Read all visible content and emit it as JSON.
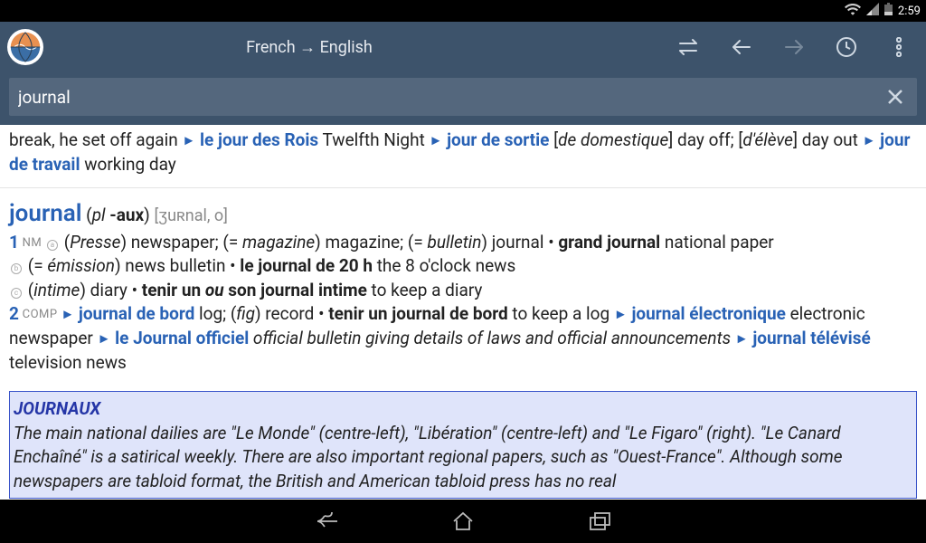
{
  "status": {
    "time": "2:59"
  },
  "header": {
    "title": "French → English"
  },
  "search": {
    "value": "journal"
  },
  "prev": {
    "lead": "break, he set off again",
    "p1": "le jour des Rois",
    "t1": " Twelfth Night ",
    "p2": "jour de sortie",
    "t2a": " [",
    "t2b": "de domestique",
    "t2c": "] day off; [",
    "t2d": "d'élève",
    "t2e": "] day out ",
    "p3": "jour de travail",
    "t3": " working day"
  },
  "entry": {
    "headword": "journal",
    "morph_open": " (",
    "pl_label": "pl ",
    "pl_suffix": "-aux",
    "morph_close": ") ",
    "ipa": "[ʒuʀnal, o]",
    "s1_num": "1",
    "s1_pos": " NM ",
    "s1_a": " (",
    "s1_a_gloss": "Presse",
    "s1_a2": ") newspaper; (= ",
    "s1_b_gloss": "magazine",
    "s1_b2": ") magazine; (= ",
    "s1_c_gloss": "bulletin",
    "s1_c2": ") journal • ",
    "s1_d_bold": "grand journal",
    "s1_d2": " national paper",
    "s1_line2a": " (= ",
    "s1_line2a_gloss": "émission",
    "s1_line2a2": ") news bulletin • ",
    "s1_line2_bold": "le journal de 20 h",
    "s1_line2b": " the 8 o'clock news",
    "s1_line3a": " (",
    "s1_line3_gloss": "intime",
    "s1_line3a2": ") diary • ",
    "s1_line3_bold1": "tenir un ",
    "s1_line3_ital": "ou",
    "s1_line3_bold2": " son journal intime",
    "s1_line3b": " to keep a diary",
    "s2_num": "2",
    "s2_pos": " COMP ",
    "s2_p1": "journal de bord",
    "s2_t1a": " log; (",
    "s2_t1_gloss": "fig",
    "s2_t1b": ") record • ",
    "s2_t1_bold": "tenir un journal de bord",
    "s2_t1c": " to keep a log ",
    "s2_p2": "journal électronique",
    "s2_t2": " electronic newspaper ",
    "s2_p3": "le Journal officiel",
    "s2_t3_gloss": " official bulletin giving details of laws and official announcements ",
    "s2_p4": "journal télévisé",
    "s2_t4": " television news"
  },
  "box": {
    "title": "JOURNAUX",
    "body": "The main national dailies are \"Le Monde\" (centre-left), \"Libération\" (centre-left) and \"Le Figaro\" (right). \"Le Canard Enchaîné\" is a satirical weekly. There are also important regional papers, such as \"Ouest-France\". Although some newspapers are tabloid format, the British and American tabloid press has no real"
  }
}
